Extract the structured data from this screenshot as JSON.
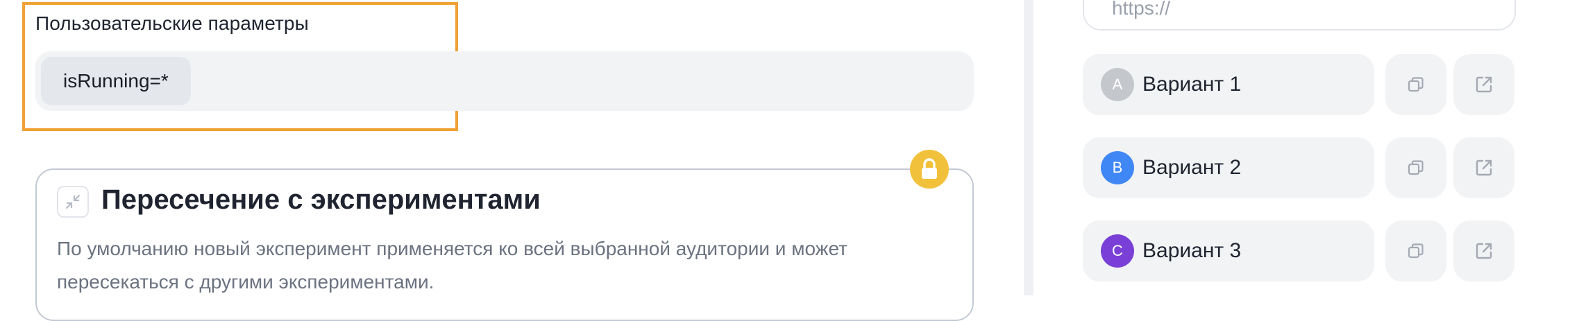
{
  "custom_params": {
    "label": "Пользовательские параметры",
    "chips": [
      "isRunning=*"
    ]
  },
  "intersection": {
    "title": "Пересечение с экспериментами",
    "description": "По умолчанию новый эксперимент применяется ко всей выбранной аудитории и может пересекаться с другими экспериментами."
  },
  "url_input": {
    "placeholder": "https://"
  },
  "variants": [
    {
      "letter": "A",
      "name": "Вариант 1",
      "color": "#c4c7cc"
    },
    {
      "letter": "B",
      "name": "Вариант 2",
      "color": "#3f87f5"
    },
    {
      "letter": "C",
      "name": "Вариант 3",
      "color": "#7a3fd6"
    }
  ],
  "colors": {
    "highlight": "#f0a134",
    "lock_badge": "#f2c13c"
  }
}
